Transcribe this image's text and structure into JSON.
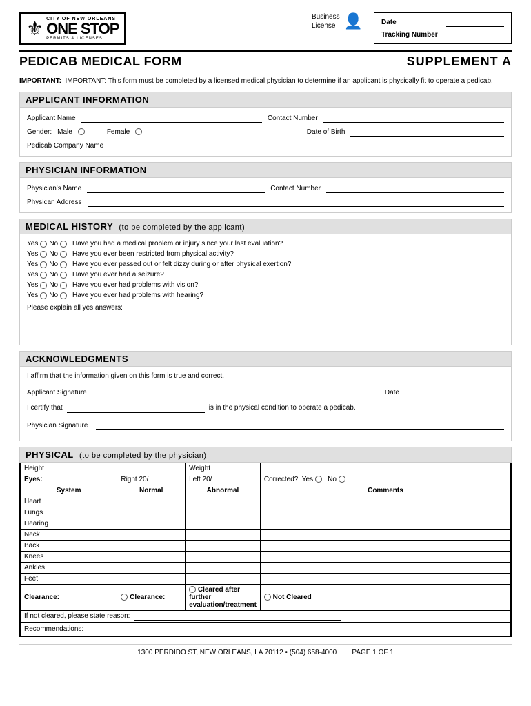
{
  "header": {
    "logo": {
      "city": "CITY OF NEW ORLEANS",
      "name": "ONE STOP",
      "sub": "PERMITS & LICENSES"
    },
    "business_license_label": "Business\nLicense",
    "date_label": "Date",
    "tracking_label": "Tracking Number"
  },
  "form_title": "PEDICAB MEDICAL FORM",
  "supplement_label": "SUPPLEMENT A",
  "important_note": "IMPORTANT:  This form must be completed by a licensed medical physician to determine if an applicant is physically fit to operate a pedicab.",
  "sections": {
    "applicant": {
      "header": "APPLICANT INFORMATION",
      "fields": {
        "applicant_name": "Applicant Name",
        "contact_number": "Contact Number",
        "gender": "Gender:",
        "male": "Male",
        "female": "Female",
        "dob": "Date of Birth",
        "company": "Pedicab Company Name"
      }
    },
    "physician": {
      "header": "PHYSICIAN INFORMATION",
      "fields": {
        "physician_name": "Physician's Name",
        "contact_number": "Contact Number",
        "address": "Physican Address"
      }
    },
    "medical_history": {
      "header": "MEDICAL HISTORY",
      "subheader": "(to be completed by the applicant)",
      "questions": [
        "Have you had a medical problem or injury since your last evaluation?",
        "Have you ever been restricted from physical activity?",
        "Have you ever passed out or felt dizzy during or after physical exertion?",
        "Have you ever had a seizure?",
        "Have you ever had problems with vision?",
        "Have you ever had problems with hearing?"
      ],
      "yes_label": "Yes",
      "no_label": "No",
      "explain_label": "Please explain all yes answers:"
    },
    "acknowledgments": {
      "header": "ACKNOWLEDGMENTS",
      "affirm_text": "I affirm that the information given on this form is true and correct.",
      "applicant_sig": "Applicant Signature",
      "date_label": "Date",
      "certify_prefix": "I certify that",
      "certify_suffix": "is in the physical condition to operate a pedicab.",
      "physician_sig": "Physician Signature"
    },
    "physical": {
      "header": "PHYSICAL",
      "subheader": "(to be completed by the physician)",
      "rows": {
        "height_label": "Height",
        "weight_label": "Weight",
        "eyes_label": "Eyes:",
        "right_label": "Right 20/",
        "left_label": "Left 20/",
        "corrected_label": "Corrected?",
        "yes_label": "Yes",
        "no_label": "No"
      },
      "table_headers": {
        "system": "System",
        "normal": "Normal",
        "abnormal": "Abnormal",
        "comments": "Comments"
      },
      "table_rows": [
        "Heart",
        "Lungs",
        "Hearing",
        "Neck",
        "Back",
        "Knees",
        "Ankles",
        "Feet"
      ],
      "clearance": {
        "label": "Clearance:",
        "option1": "Clearance:",
        "option2": "Cleared after further evaluation/treatment",
        "option3": "Not Cleared"
      },
      "if_not_cleared": "If not cleared, please state reason:",
      "recommendations": "Recommendations:"
    }
  },
  "footer": {
    "address": "1300 PERDIDO ST, NEW ORLEANS, LA 70112 • (504) 658-4000",
    "page": "PAGE 1 OF 1"
  }
}
